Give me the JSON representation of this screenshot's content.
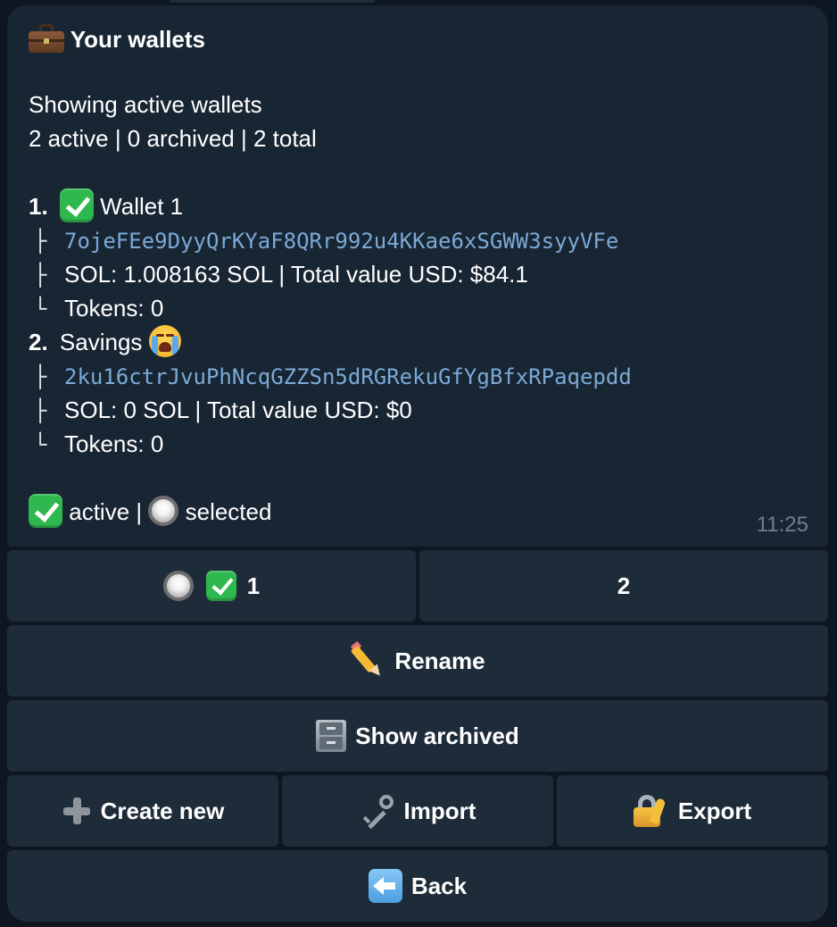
{
  "message": {
    "title": "Your wallets",
    "subtitle": "Showing active wallets",
    "counts": "2 active | 0 archived | 2 total",
    "wallets": [
      {
        "index": "1.",
        "name": "Wallet 1",
        "address": "7ojeFEe9DyyQrKYaF8QRr992u4KKae6xSGWW3syyVFe",
        "sol_line": "SOL: 1.008163 SOL | Total value USD: $84.1",
        "tokens_line": "Tokens: 0",
        "active": true
      },
      {
        "index": "2.",
        "name": "Savings",
        "address": "2ku16ctrJvuPhNcqGZZSn5dRGRekuGfYgBfxRPaqepdd",
        "sol_line": "SOL: 0 SOL | Total value USD: $0",
        "tokens_line": "Tokens: 0",
        "active": false
      }
    ],
    "legend_active": "active |",
    "legend_selected": "selected",
    "time": "11:25"
  },
  "tree": {
    "branch": "├",
    "last": "└"
  },
  "keyboard": {
    "wallet_1_label": "1",
    "wallet_2_label": "2",
    "rename": "Rename",
    "show_archived": "Show archived",
    "create_new": "Create new",
    "import": "Import",
    "export": "Export",
    "back": "Back"
  },
  "icons": {
    "title": "briefcase-icon",
    "active": "check-mark-icon",
    "selected": "radio-button-icon",
    "savings": "crying-face-icon",
    "rename": "pencil-icon",
    "show_archived": "file-cabinet-icon",
    "create_new": "plus-icon",
    "import": "key-icon",
    "export": "lock-with-key-icon",
    "back": "back-arrow-icon"
  },
  "colors": {
    "background": "#0e1621",
    "bubble": "#182533",
    "button": "#1e2c3a",
    "address": "#7ba9d6",
    "timestamp": "#6d7f8f",
    "check": "#2fb84f"
  }
}
